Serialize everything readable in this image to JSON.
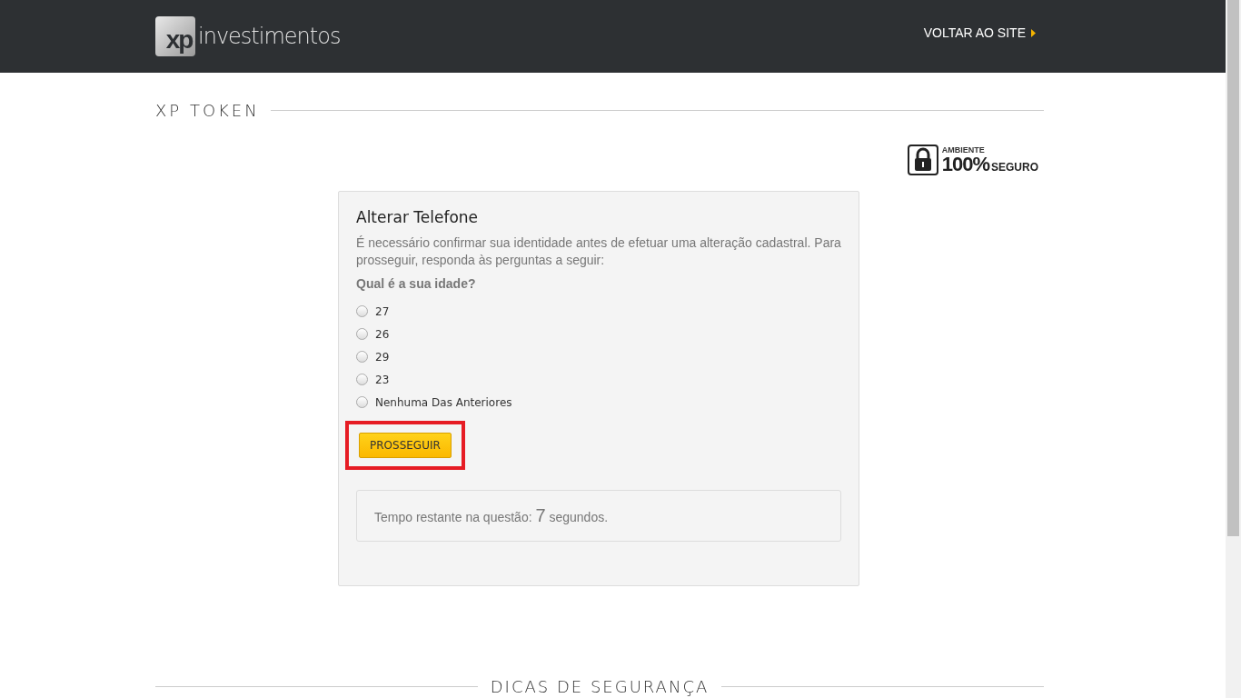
{
  "header": {
    "logo_mark": "xp",
    "logo_text": "investimentos",
    "back_link": "VOLTAR AO SITE"
  },
  "section_title": "XP TOKEN",
  "security_badge": {
    "top": "AMBIENTE",
    "big": "100%",
    "bottom": "SEGURO"
  },
  "card": {
    "title": "Alterar Telefone",
    "description": "É necessário confirmar sua identidade antes de efetuar uma alteração cadastral. Para prosseguir, responda às perguntas a seguir:",
    "question": "Qual é a sua idade?",
    "options": [
      {
        "label": "27",
        "selected": false
      },
      {
        "label": "26",
        "selected": false
      },
      {
        "label": "29",
        "selected": false
      },
      {
        "label": "23",
        "selected": false
      },
      {
        "label": "Nenhuma Das Anteriores",
        "selected": false
      }
    ],
    "button": {
      "label": "PROSSEGUIR",
      "highlighted": true
    },
    "timer": {
      "prefix": "Tempo restante na questão:",
      "seconds": "7",
      "suffix": "segundos."
    }
  },
  "footer_title": "DICAS DE SEGURANÇA"
}
